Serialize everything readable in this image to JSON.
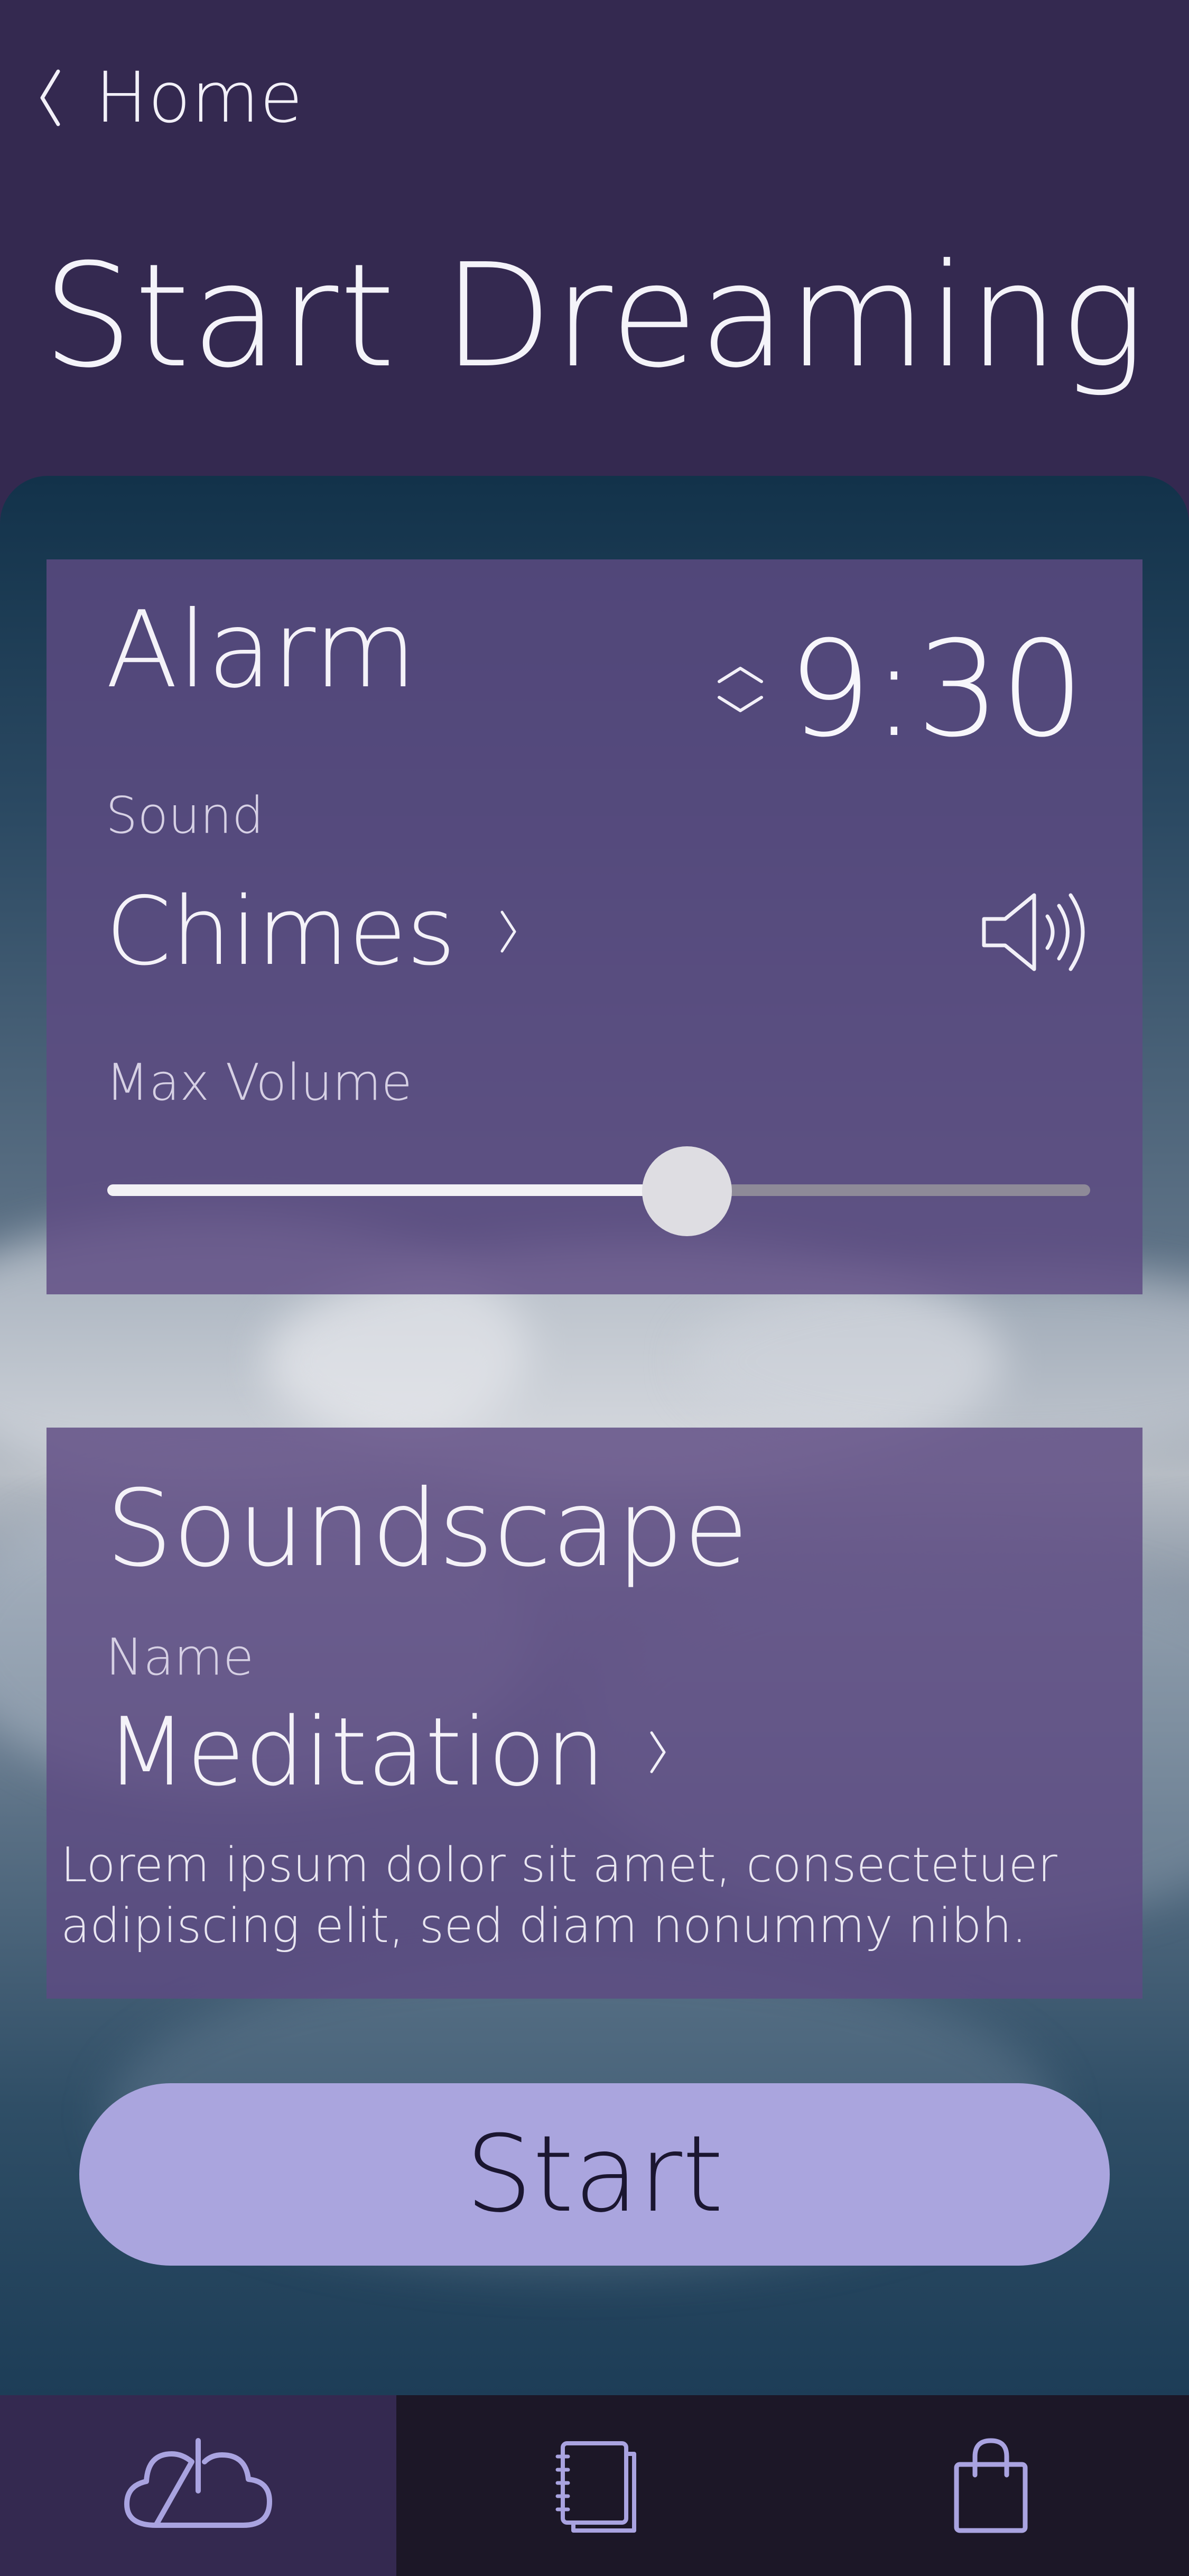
{
  "nav": {
    "back_label": "Home"
  },
  "page": {
    "title": "Start Dreaming"
  },
  "alarm": {
    "heading": "Alarm",
    "time": "9:30",
    "sound_label": "Sound",
    "sound_value": "Chimes",
    "volume_label": "Max Volume",
    "volume_level": 0.59
  },
  "soundscape": {
    "heading": "Soundscape",
    "name_label": "Name",
    "name_value": "Meditation",
    "description": "Lorem ipsum dolor sit amet, consectetuer adipiscing elit, sed diam nonummy nibh."
  },
  "actions": {
    "start_label": "Start"
  },
  "tabs": [
    {
      "icon": "cloud-power-icon",
      "active": true
    },
    {
      "icon": "notebook-icon",
      "active": false
    },
    {
      "icon": "shopping-bag-icon",
      "active": false
    }
  ],
  "colors": {
    "header_bg": "#342950",
    "card_bg": "#5e4a82",
    "button_bg": "#aaa5de",
    "tabbar_bg": "#1c1727",
    "icon_accent": "#a9a3e0"
  }
}
